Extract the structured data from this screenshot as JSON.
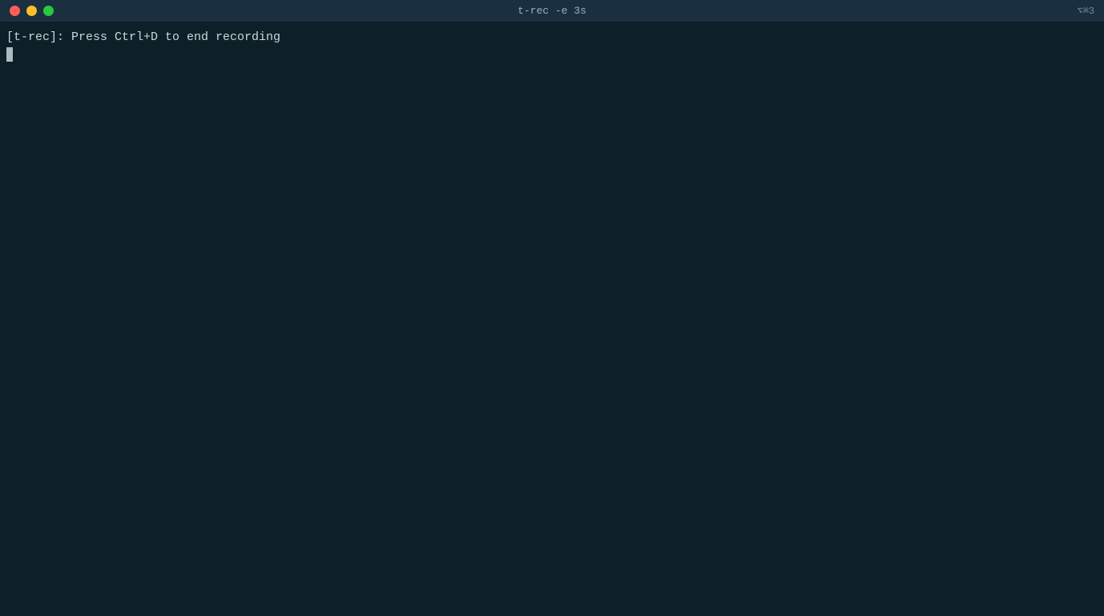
{
  "titlebar": {
    "title": "t-rec -e 3s",
    "shortcut": "⌥⌘3",
    "buttons": {
      "close_label": "close",
      "minimize_label": "minimize",
      "maximize_label": "maximize"
    }
  },
  "terminal": {
    "background_color": "#0d2027",
    "line1": "[t-rec]: Press Ctrl+D to end recording",
    "prompt": ""
  }
}
